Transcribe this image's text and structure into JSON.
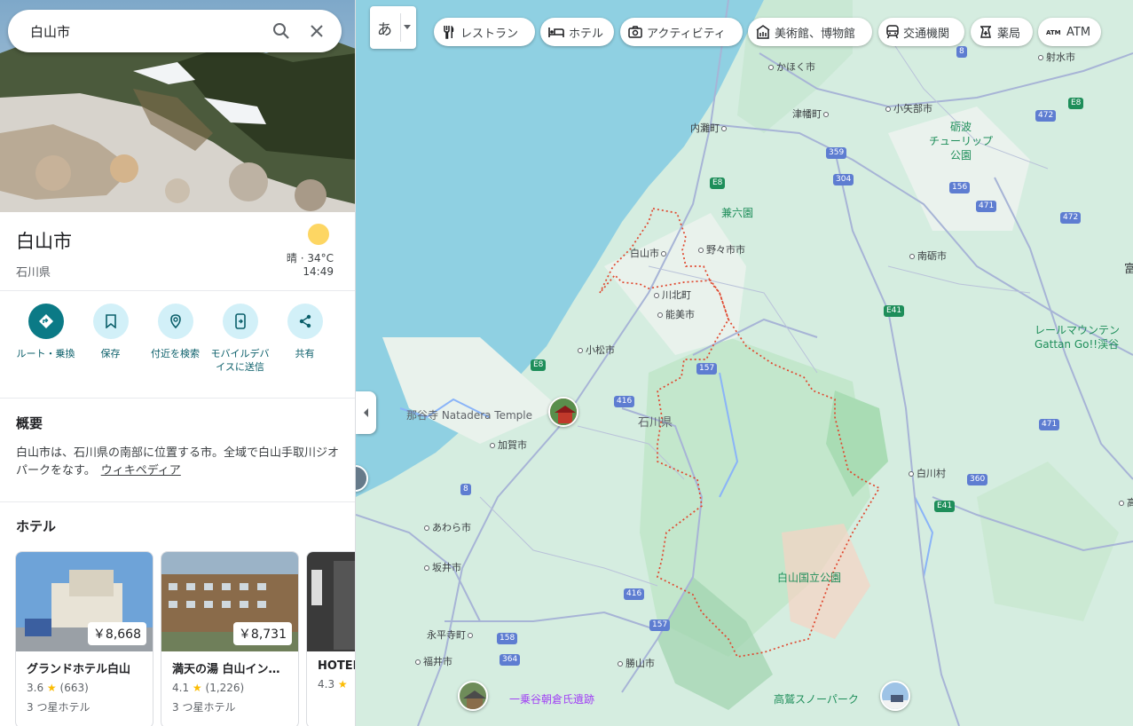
{
  "search": {
    "value": "白山市",
    "search_icon": "search-icon",
    "close_icon": "close-icon"
  },
  "place": {
    "title": "白山市",
    "subtitle": "石川県"
  },
  "weather": {
    "condition": "晴 · 34°C",
    "time": "14:49"
  },
  "actions": [
    {
      "label": "ルート・乗換",
      "icon": "directions-icon"
    },
    {
      "label": "保存",
      "icon": "bookmark-icon"
    },
    {
      "label": "付近を検索",
      "icon": "nearby-icon"
    },
    {
      "label": "モバイルデバイスに送信",
      "icon": "send-to-phone-icon"
    },
    {
      "label": "共有",
      "icon": "share-icon"
    }
  ],
  "overview": {
    "heading": "概要",
    "text": "白山市は、石川県の南部に位置する市。全域で白山手取川ジオパークをなす。",
    "link": "ウィキペディア"
  },
  "hotels": {
    "heading": "ホテル",
    "items": [
      {
        "name": "グランドホテル白山",
        "price": "￥8,668",
        "rating": "3.6",
        "reviews": "(663)",
        "class": "3 つ星ホテル"
      },
      {
        "name": "満天の湯 白山イン…",
        "price": "￥8,731",
        "rating": "4.1",
        "reviews": "(1,226)",
        "class": "3 つ星ホテル"
      },
      {
        "name": "HOTEL",
        "price": "",
        "rating": "4.3",
        "reviews": "",
        "class": ""
      }
    ]
  },
  "map": {
    "lang_button": "あ",
    "chips": [
      {
        "label": "レストラン",
        "icon": "restaurant-icon"
      },
      {
        "label": "ホテル",
        "icon": "hotel-icon"
      },
      {
        "label": "アクティビティ",
        "icon": "camera-icon"
      },
      {
        "label": "美術館、博物館",
        "icon": "museum-icon"
      },
      {
        "label": "交通機関",
        "icon": "transit-icon"
      },
      {
        "label": "薬局",
        "icon": "pharmacy-icon"
      },
      {
        "label": "ATM",
        "icon": "atm-icon"
      }
    ],
    "places": [
      {
        "label": "かほく市"
      },
      {
        "label": "射水市"
      },
      {
        "label": "津幡町"
      },
      {
        "label": "小矢部市"
      },
      {
        "label": "内灘町"
      },
      {
        "label": "白山市"
      },
      {
        "label": "野々市市"
      },
      {
        "label": "南砺市"
      },
      {
        "label": "川北町"
      },
      {
        "label": "能美市"
      },
      {
        "label": "小松市"
      },
      {
        "label": "加賀市"
      },
      {
        "label": "白川村"
      },
      {
        "label": "あわら市"
      },
      {
        "label": "坂井市"
      },
      {
        "label": "永平寺町"
      },
      {
        "label": "福井市"
      },
      {
        "label": "勝山市"
      }
    ],
    "region_label": "石川県",
    "green_labels": {
      "tonami": "砺波\nチューリップ\n公園",
      "kenrokuen": "兼六園",
      "hakusan_park": "白山国立公園",
      "takasu": "高鷲スノーパーク",
      "gattan": "レールマウンテン\nGattan Go!!渓谷",
      "ichijodani": "一乗谷朝倉氏遺跡",
      "natadera": "那谷寺 Natadera Temple"
    },
    "road_shields": [
      "8",
      "472",
      "E8",
      "359",
      "304",
      "156",
      "471",
      "472",
      "E8",
      "E41",
      "157",
      "416",
      "8",
      "471",
      "360",
      "E41",
      "E8",
      "416",
      "158",
      "157",
      "364"
    ],
    "edge_labels": [
      "富",
      "高"
    ]
  },
  "colors": {
    "accent": "#0b7a86",
    "water": "#8fd0e2",
    "land": "#d8efe0",
    "border_dashed": "#e0472e",
    "park": "#bfe8c8"
  }
}
